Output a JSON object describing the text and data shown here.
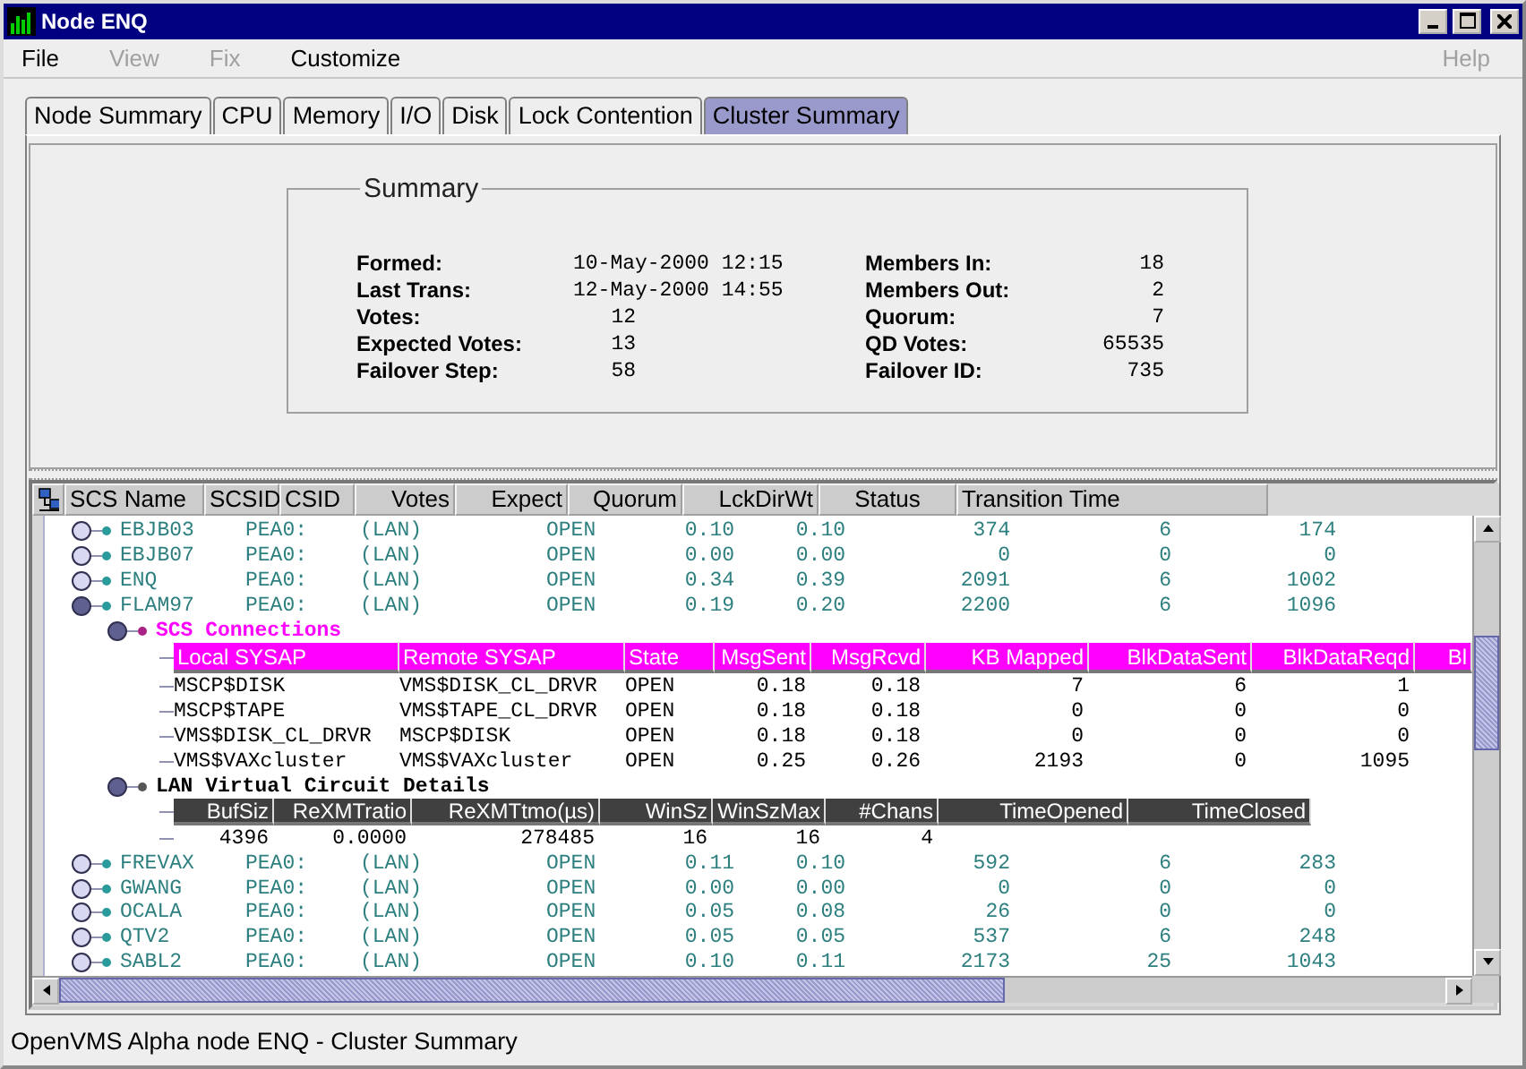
{
  "window": {
    "title": "Node ENQ"
  },
  "menu": [
    {
      "label": "File",
      "disabled": false
    },
    {
      "label": "View",
      "disabled": true
    },
    {
      "label": "Fix",
      "disabled": true
    },
    {
      "label": "Customize",
      "disabled": false
    },
    {
      "label": "Help",
      "disabled": true
    }
  ],
  "tabs": [
    {
      "label": "Node Summary",
      "selected": false
    },
    {
      "label": "CPU",
      "selected": false
    },
    {
      "label": "Memory",
      "selected": false
    },
    {
      "label": "I/O",
      "selected": false
    },
    {
      "label": "Disk",
      "selected": false
    },
    {
      "label": "Lock Contention",
      "selected": false
    },
    {
      "label": "Cluster Summary",
      "selected": true
    }
  ],
  "summary": {
    "title": "Summary",
    "left": [
      {
        "label": "Formed:",
        "value": "10-May-2000 12:15"
      },
      {
        "label": "Last Trans:",
        "value": "12-May-2000 14:55"
      },
      {
        "label": "Votes:",
        "value": "12"
      },
      {
        "label": "Expected Votes:",
        "value": "13"
      },
      {
        "label": "Failover Step:",
        "value": "58"
      }
    ],
    "right": [
      {
        "label": "Members In:",
        "value": "18"
      },
      {
        "label": "Members Out:",
        "value": "2"
      },
      {
        "label": "Quorum:",
        "value": "7"
      },
      {
        "label": "QD Votes:",
        "value": "65535"
      },
      {
        "label": "Failover ID:",
        "value": "735"
      }
    ]
  },
  "table": {
    "columns": [
      "SCS Name",
      "SCSID",
      "CSID",
      "Votes",
      "Expect",
      "Quorum",
      "LckDirWt",
      "Status",
      "Transition Time"
    ],
    "rows": [
      {
        "name": "EBJB03",
        "expanded": false,
        "cells": [
          "PEA0:",
          "(LAN)",
          "OPEN",
          "0.10",
          "0.10",
          "374",
          "6",
          "174"
        ]
      },
      {
        "name": "EBJB07",
        "expanded": false,
        "cells": [
          "PEA0:",
          "(LAN)",
          "OPEN",
          "0.00",
          "0.00",
          "0",
          "0",
          "0"
        ]
      },
      {
        "name": "ENQ",
        "expanded": false,
        "cells": [
          "PEA0:",
          "(LAN)",
          "OPEN",
          "0.34",
          "0.39",
          "2091",
          "6",
          "1002"
        ]
      },
      {
        "name": "FLAM97",
        "expanded": true,
        "cells": [
          "PEA0:",
          "(LAN)",
          "OPEN",
          "0.19",
          "0.20",
          "2200",
          "6",
          "1096"
        ],
        "children": [
          {
            "kind": "scs",
            "label": "SCS Connections",
            "expanded": true,
            "columns": [
              "Local SYSAP",
              "Remote SYSAP",
              "State",
              "MsgSent",
              "MsgRcvd",
              "KB Mapped",
              "BlkDataSent",
              "BlkDataReqd",
              "Bl"
            ],
            "rows": [
              [
                "MSCP$DISK",
                "VMS$DISK_CL_DRVR",
                "OPEN",
                "0.18",
                "0.18",
                "7",
                "6",
                "1"
              ],
              [
                "MSCP$TAPE",
                "VMS$TAPE_CL_DRVR",
                "OPEN",
                "0.18",
                "0.18",
                "0",
                "0",
                "0"
              ],
              [
                "VMS$DISK_CL_DRVR",
                "MSCP$DISK",
                "OPEN",
                "0.18",
                "0.18",
                "0",
                "0",
                "0"
              ],
              [
                "VMS$VAXcluster",
                "VMS$VAXcluster",
                "OPEN",
                "0.25",
                "0.26",
                "2193",
                "0",
                "1095"
              ]
            ]
          },
          {
            "kind": "lan",
            "label": "LAN Virtual Circuit Details",
            "expanded": true,
            "columns": [
              "BufSiz",
              "ReXMTratio",
              "ReXMTtmo(µs)",
              "WinSz",
              "WinSzMax",
              "#Chans",
              "TimeOpened",
              "TimeClosed"
            ],
            "rows": [
              [
                "4396",
                "0.0000",
                "278485",
                "16",
                "16",
                "4"
              ]
            ]
          }
        ]
      },
      {
        "name": "FREVAX",
        "expanded": false,
        "cells": [
          "PEA0:",
          "(LAN)",
          "OPEN",
          "0.11",
          "0.10",
          "592",
          "6",
          "283"
        ]
      },
      {
        "name": "GWANG",
        "expanded": false,
        "cells": [
          "PEA0:",
          "(LAN)",
          "OPEN",
          "0.00",
          "0.00",
          "0",
          "0",
          "0"
        ]
      },
      {
        "name": "OCALA",
        "expanded": false,
        "cells": [
          "PEA0:",
          "(LAN)",
          "OPEN",
          "0.05",
          "0.08",
          "26",
          "0",
          "0"
        ]
      },
      {
        "name": "QTV2",
        "expanded": false,
        "cells": [
          "PEA0:",
          "(LAN)",
          "OPEN",
          "0.05",
          "0.05",
          "537",
          "6",
          "248"
        ]
      },
      {
        "name": "SABL2",
        "expanded": false,
        "cells": [
          "PEA0:",
          "(LAN)",
          "OPEN",
          "0.10",
          "0.11",
          "2173",
          "25",
          "1043"
        ]
      }
    ]
  },
  "status_bar": "OpenVMS Alpha node ENQ - Cluster Summary"
}
